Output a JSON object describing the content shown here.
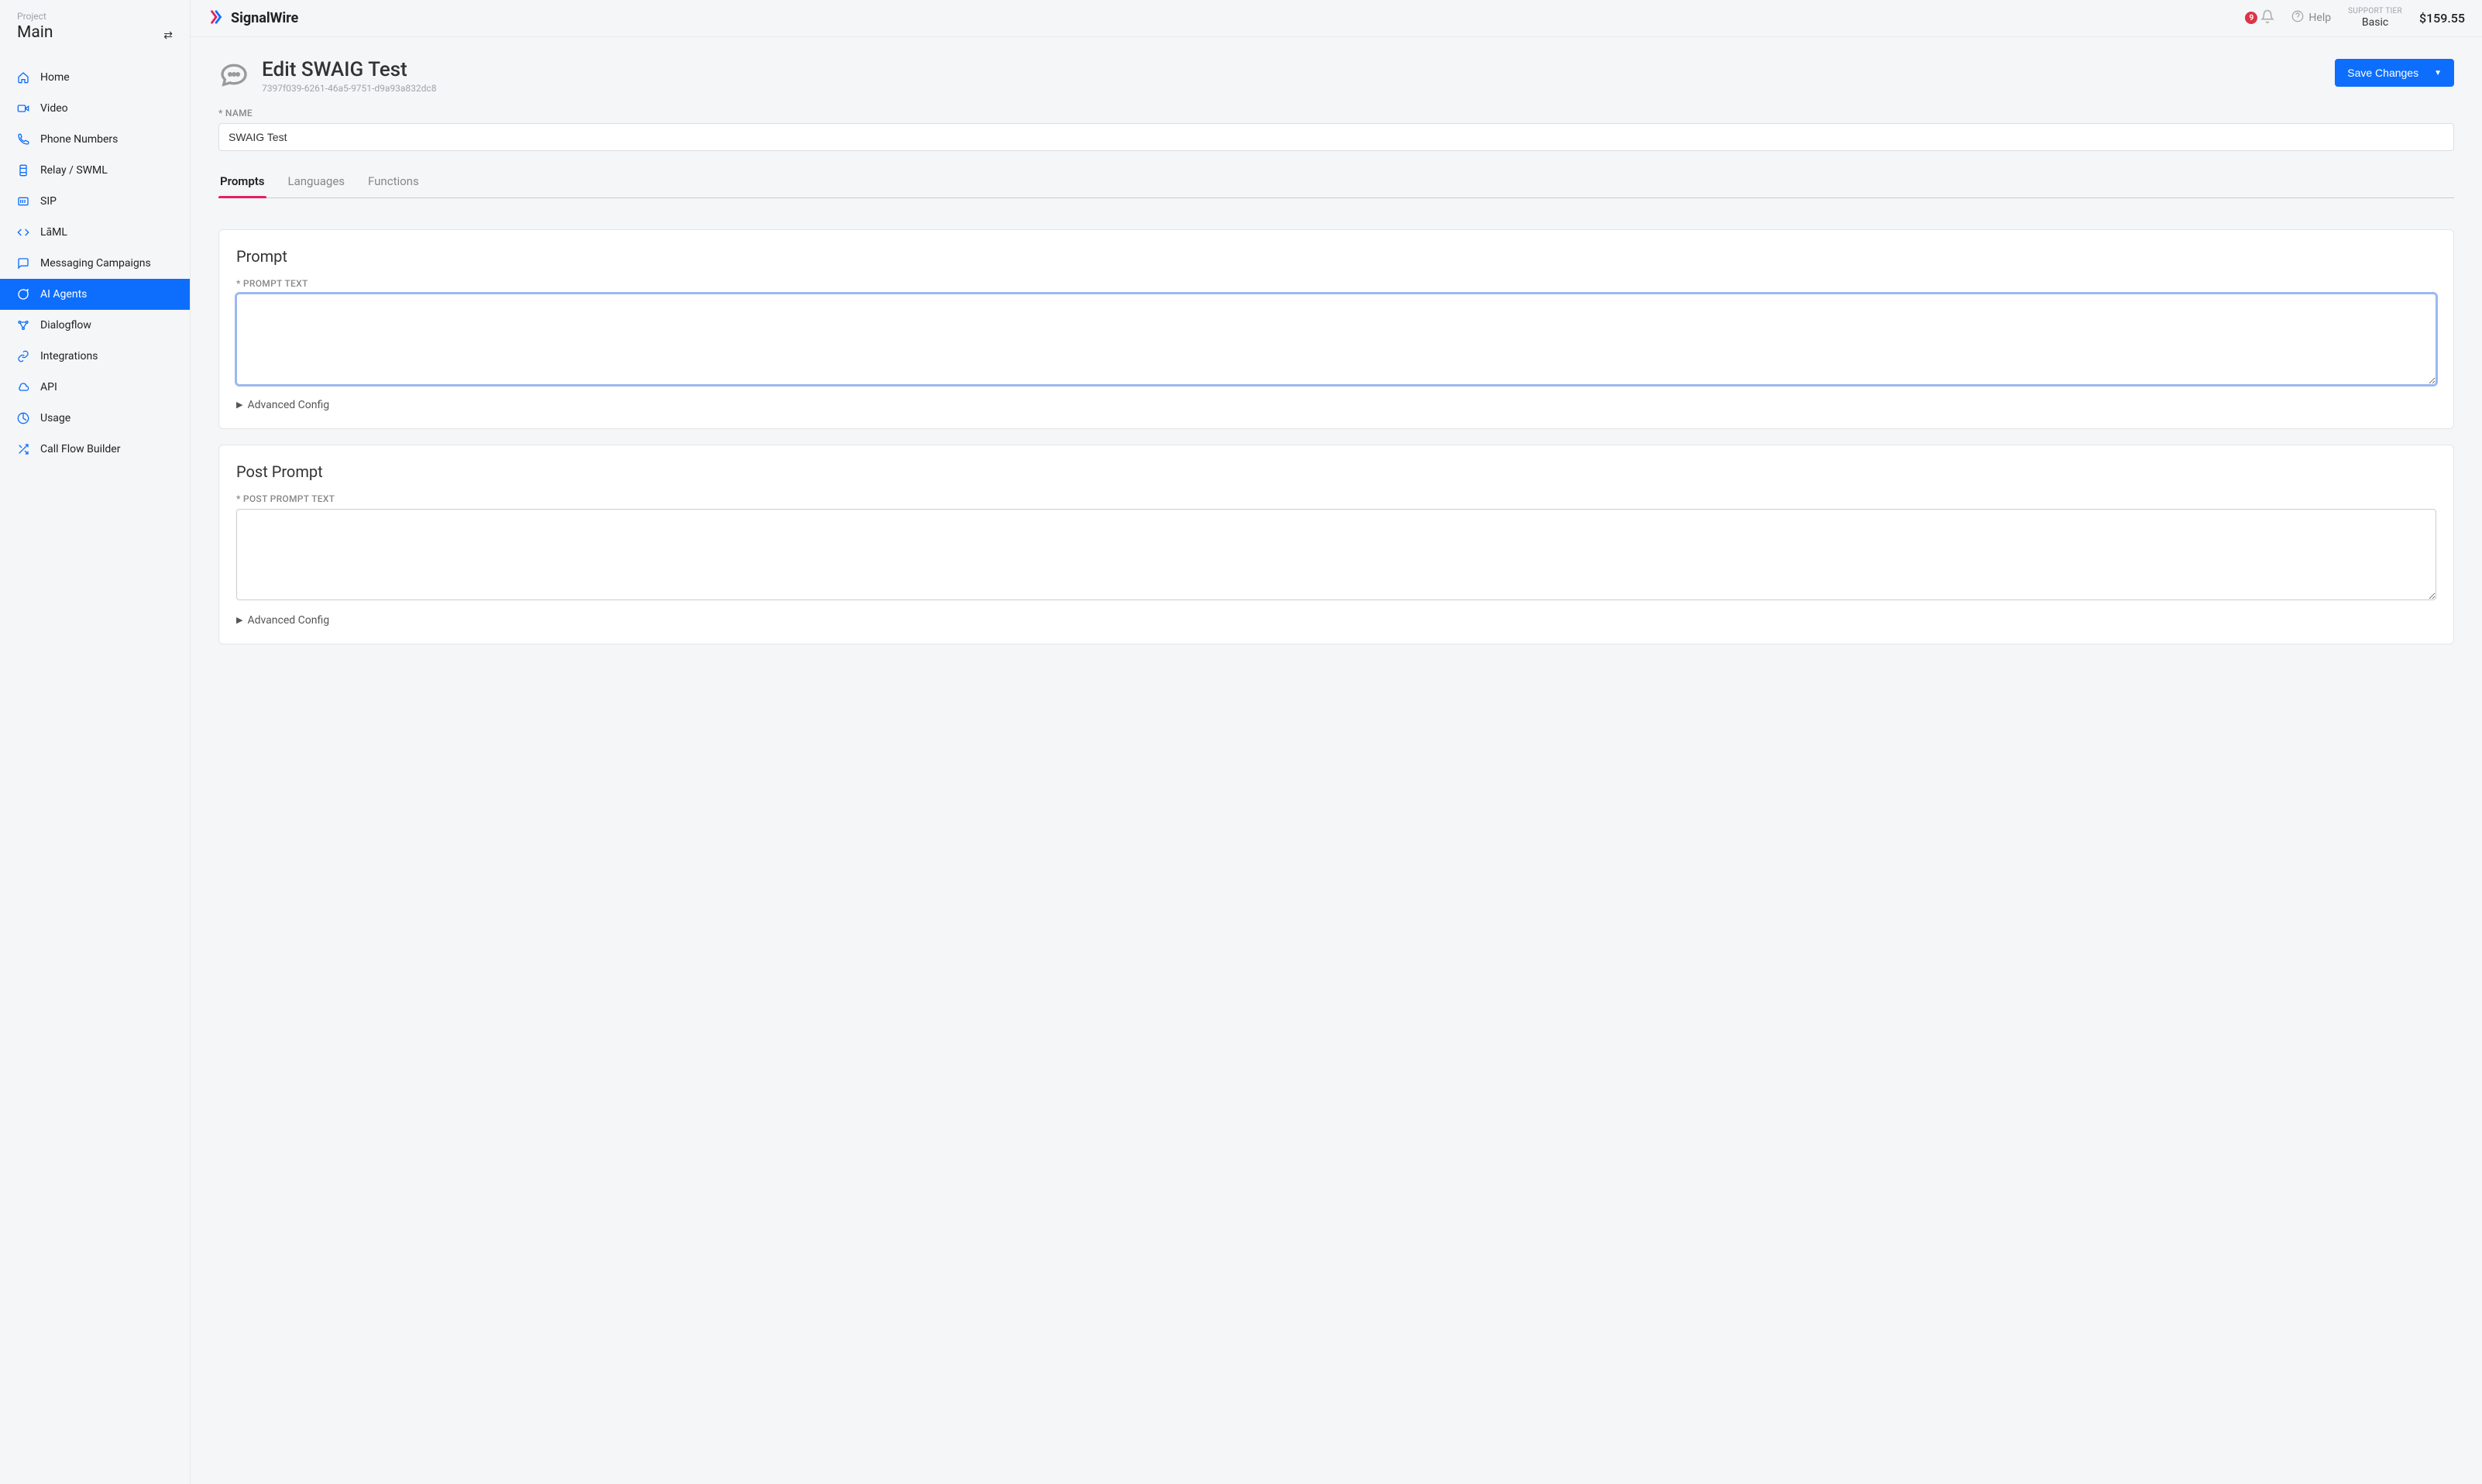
{
  "sidebar": {
    "project_label": "Project",
    "project_name": "Main",
    "items": [
      {
        "label": "Home",
        "icon": "home-icon"
      },
      {
        "label": "Video",
        "icon": "video-icon"
      },
      {
        "label": "Phone Numbers",
        "icon": "phone-icon"
      },
      {
        "label": "Relay / SWML",
        "icon": "relay-icon"
      },
      {
        "label": "SIP",
        "icon": "sip-icon"
      },
      {
        "label": "LāML",
        "icon": "code-icon"
      },
      {
        "label": "Messaging Campaigns",
        "icon": "message-icon"
      },
      {
        "label": "AI Agents",
        "icon": "chat-icon",
        "active": true
      },
      {
        "label": "Dialogflow",
        "icon": "dialogflow-icon"
      },
      {
        "label": "Integrations",
        "icon": "link-icon"
      },
      {
        "label": "API",
        "icon": "cloud-icon"
      },
      {
        "label": "Usage",
        "icon": "usage-icon"
      },
      {
        "label": "Call Flow Builder",
        "icon": "flow-icon"
      }
    ]
  },
  "topbar": {
    "brand": "SignalWire",
    "notif_count": "9",
    "help_label": "Help",
    "tier_label": "SUPPORT TIER",
    "tier_value": "Basic",
    "balance": "$159.55"
  },
  "page": {
    "title": "Edit SWAIG Test",
    "id": "7397f039-6261-46a5-9751-d9a93a832dc8",
    "save_label": "Save Changes",
    "name_label": "* NAME",
    "name_value": "SWAIG Test"
  },
  "tabs": [
    {
      "label": "Prompts",
      "active": true
    },
    {
      "label": "Languages"
    },
    {
      "label": "Functions"
    }
  ],
  "prompt_card": {
    "title": "Prompt",
    "text_label": "* PROMPT TEXT",
    "text_value": "",
    "adv_label": "Advanced Config"
  },
  "post_prompt_card": {
    "title": "Post Prompt",
    "text_label": "* POST PROMPT TEXT",
    "text_value": "",
    "adv_label": "Advanced Config"
  }
}
